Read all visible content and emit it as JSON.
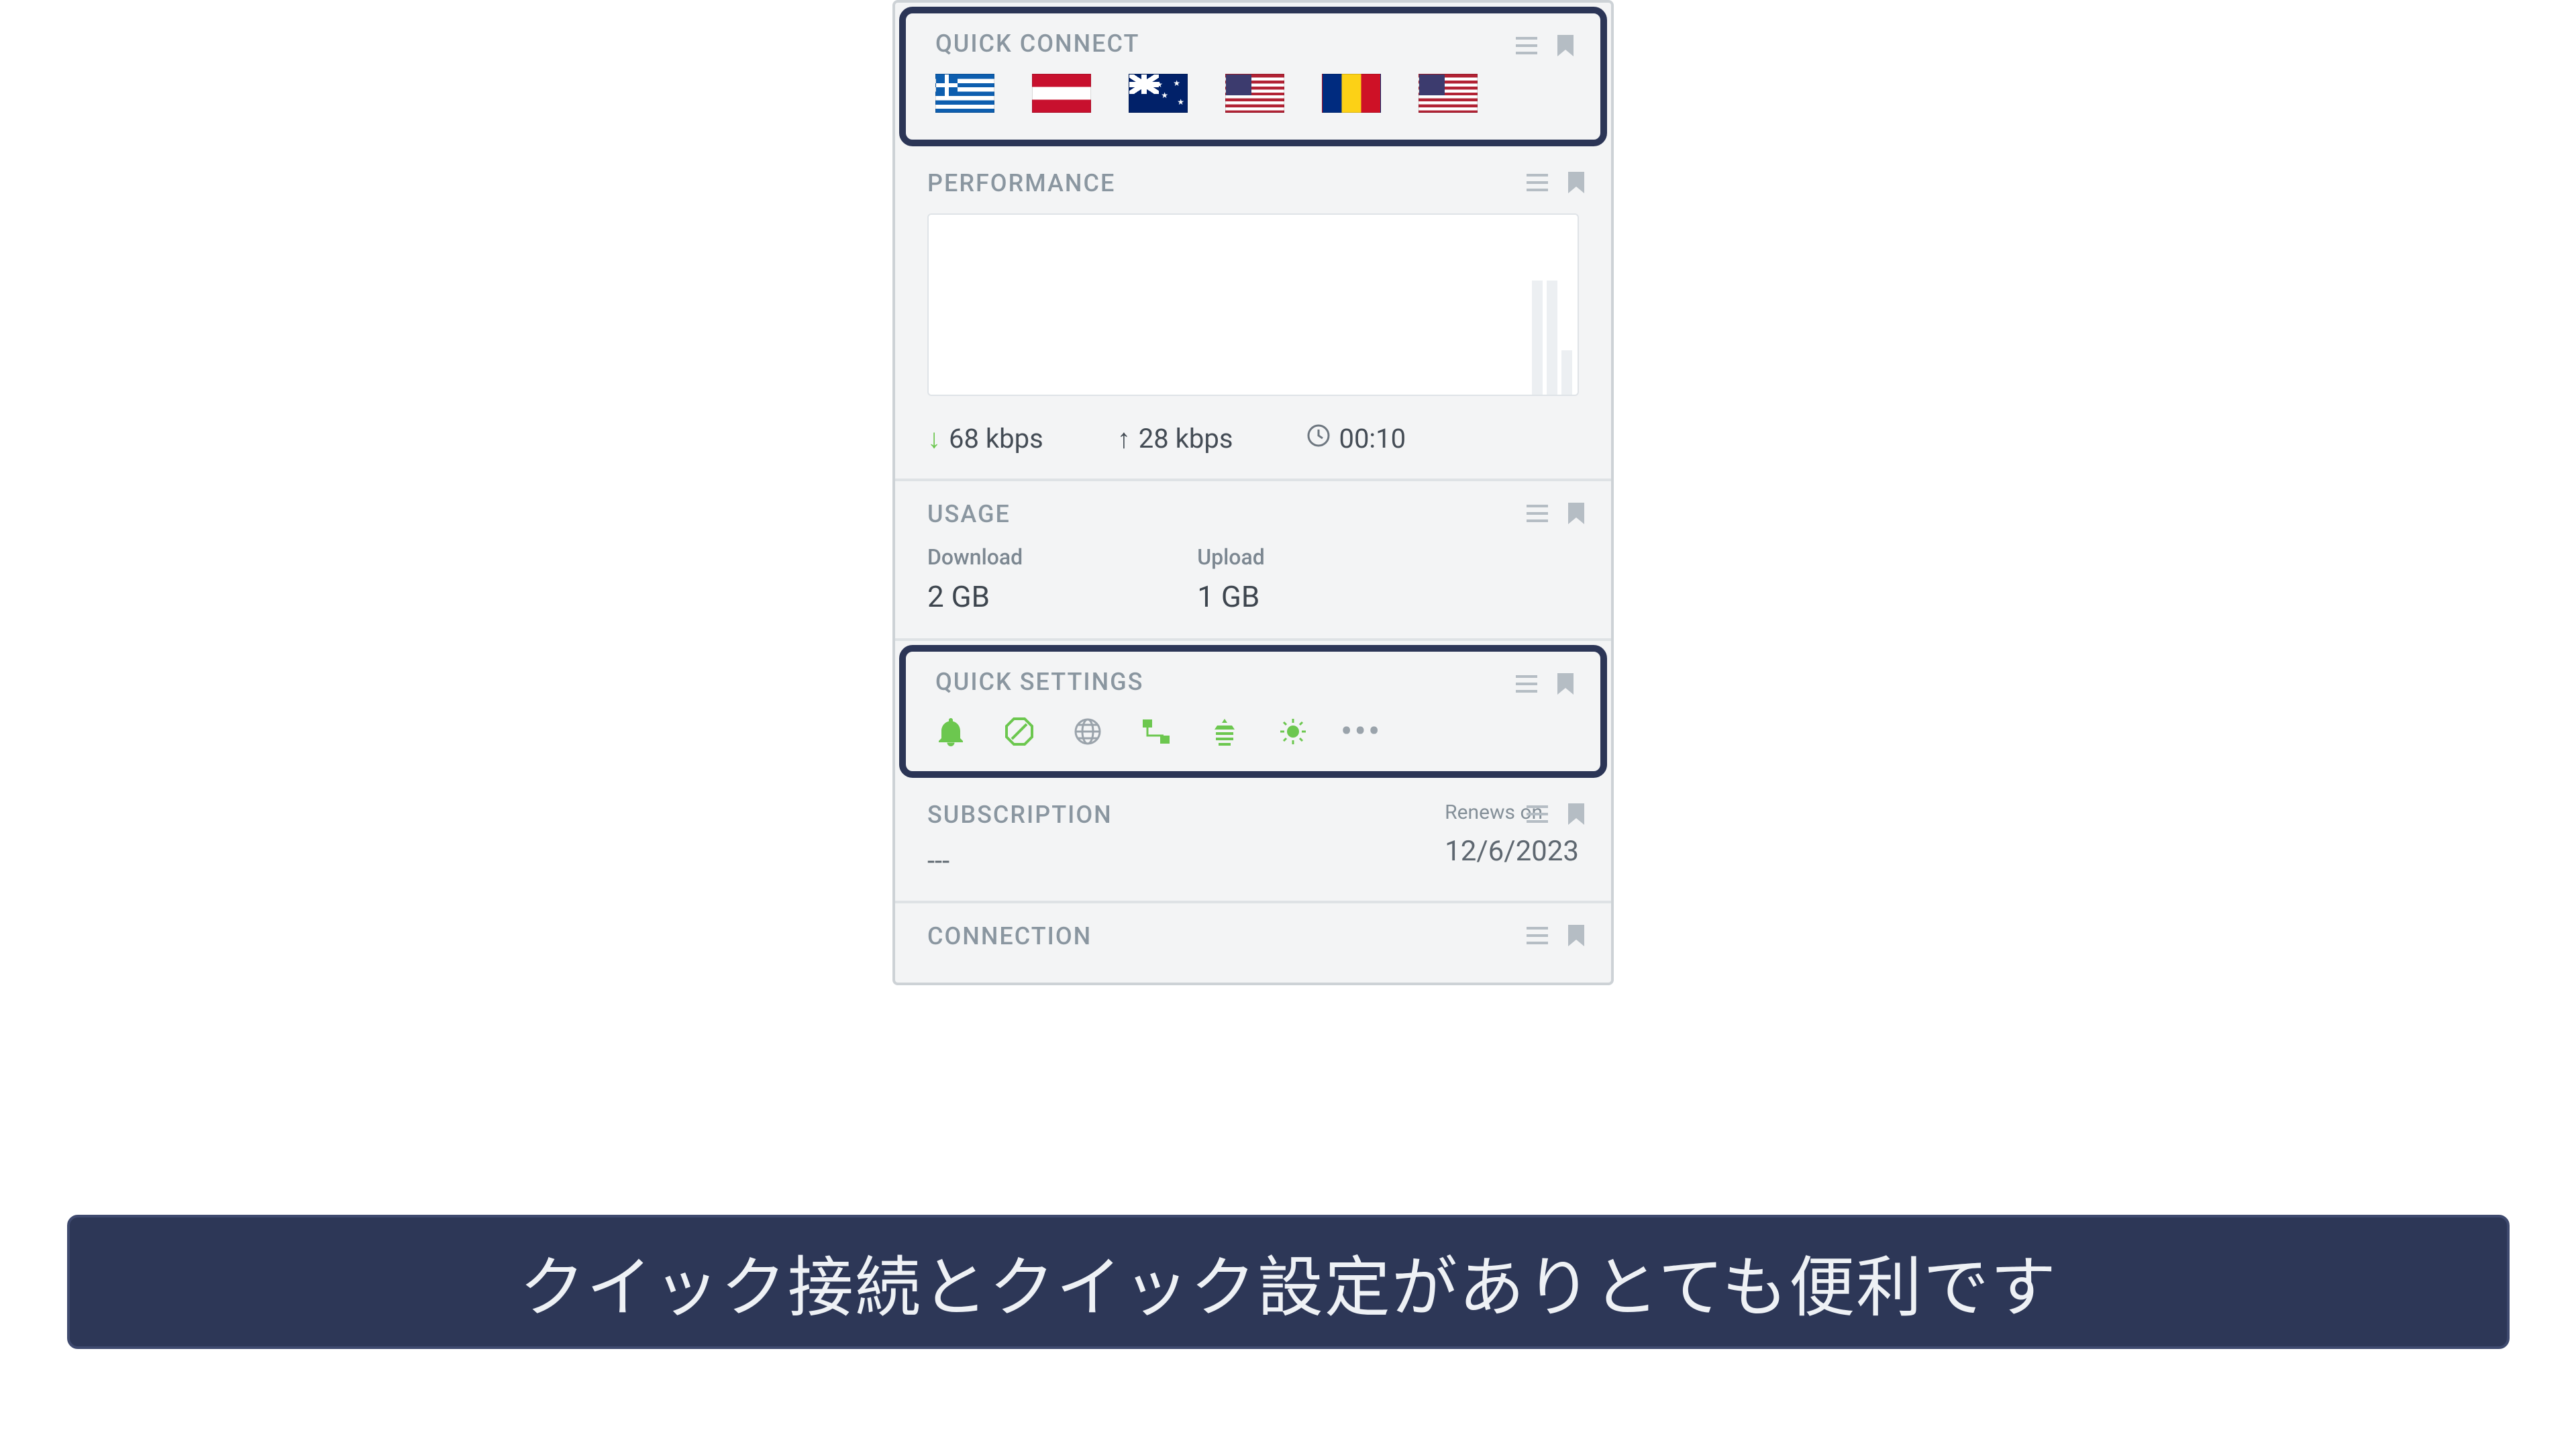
{
  "quickConnect": {
    "title": "QUICK CONNECT",
    "flags": [
      "greece",
      "austria",
      "australia",
      "usa",
      "romania",
      "usa"
    ]
  },
  "performance": {
    "title": "PERFORMANCE",
    "download_speed": "68 kbps",
    "upload_speed": "28 kbps",
    "duration": "00:10"
  },
  "usage": {
    "title": "USAGE",
    "download_label": "Download",
    "download_value": "2 GB",
    "upload_label": "Upload",
    "upload_value": "1 GB"
  },
  "quickSettings": {
    "title": "QUICK SETTINGS"
  },
  "subscription": {
    "title": "SUBSCRIPTION",
    "plan": "---",
    "renews_label": "Renews on",
    "renews_date": "12/6/2023"
  },
  "connection": {
    "title": "CONNECTION"
  },
  "caption": "クイック接続とクイック設定がありとても便利です"
}
